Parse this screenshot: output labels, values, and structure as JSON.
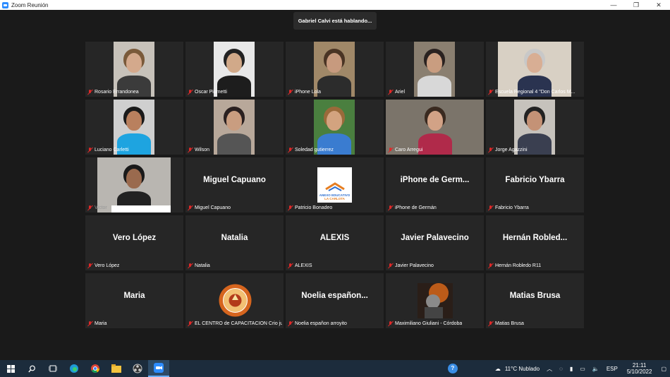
{
  "window": {
    "title": "Zoom Reunión",
    "minimize": "—",
    "maximize": "❐",
    "close": "✕"
  },
  "speaker_banner": "Gabriel Calvi está hablando...",
  "participants": [
    {
      "label": "Rosario Errandonea",
      "video": true
    },
    {
      "label": "Oscar Piumetti",
      "video": true
    },
    {
      "label": "iPhone Lola",
      "video": true
    },
    {
      "label": "Ariel",
      "video": true
    },
    {
      "label": "Escuela Regional 4 \"Don Carlos M...",
      "video": true
    },
    {
      "label": "Luciano Carletti",
      "video": true
    },
    {
      "label": "Wilson",
      "video": true
    },
    {
      "label": "Soledad gutierrez",
      "video": true
    },
    {
      "label": "Caro Arregui",
      "video": true
    },
    {
      "label": "Jorge Agazzini",
      "video": true
    },
    {
      "label": "Victor",
      "video": true
    },
    {
      "label": "Miguel Capuano",
      "name": "Miguel Capuano"
    },
    {
      "label": "Patricio Bonadeo",
      "logo": "anexo",
      "logo_text1": "ANEXO EDUCATIVO",
      "logo_text2": "LA CARLOTA"
    },
    {
      "label": "iPhone de Germán",
      "name": "iPhone de Germ..."
    },
    {
      "label": "Fabricio Ybarra",
      "name": "Fabricio Ybarra"
    },
    {
      "label": "Vero López",
      "name": "Vero López"
    },
    {
      "label": "Natalia",
      "name": "Natalia"
    },
    {
      "label": "ALEXIS",
      "name": "ALEXIS"
    },
    {
      "label": "Javier Palavecino",
      "name": "Javier Palavecino"
    },
    {
      "label": "Hernán Robledo R11",
      "name": "Hernán Robled..."
    },
    {
      "label": "Maria",
      "name": "Maria"
    },
    {
      "label": "EL CENTRO de CAPACITACION Crio ju...",
      "logo": "seal"
    },
    {
      "label": "Noelia españon arroyito",
      "name": "Noelia españon..."
    },
    {
      "label": "Maximiliano Giuliani - Córdoba",
      "logo": "photo"
    },
    {
      "label": "Matias Brusa",
      "name": "Matias Brusa"
    }
  ],
  "taskbar": {
    "weather": "11°C  Nublado",
    "language": "ESP",
    "time": "21:11",
    "date": "5/10/2022"
  },
  "colors": {
    "accent": "#2d8cff",
    "muted_mic": "#e02828",
    "tile_bg": "#262626"
  }
}
